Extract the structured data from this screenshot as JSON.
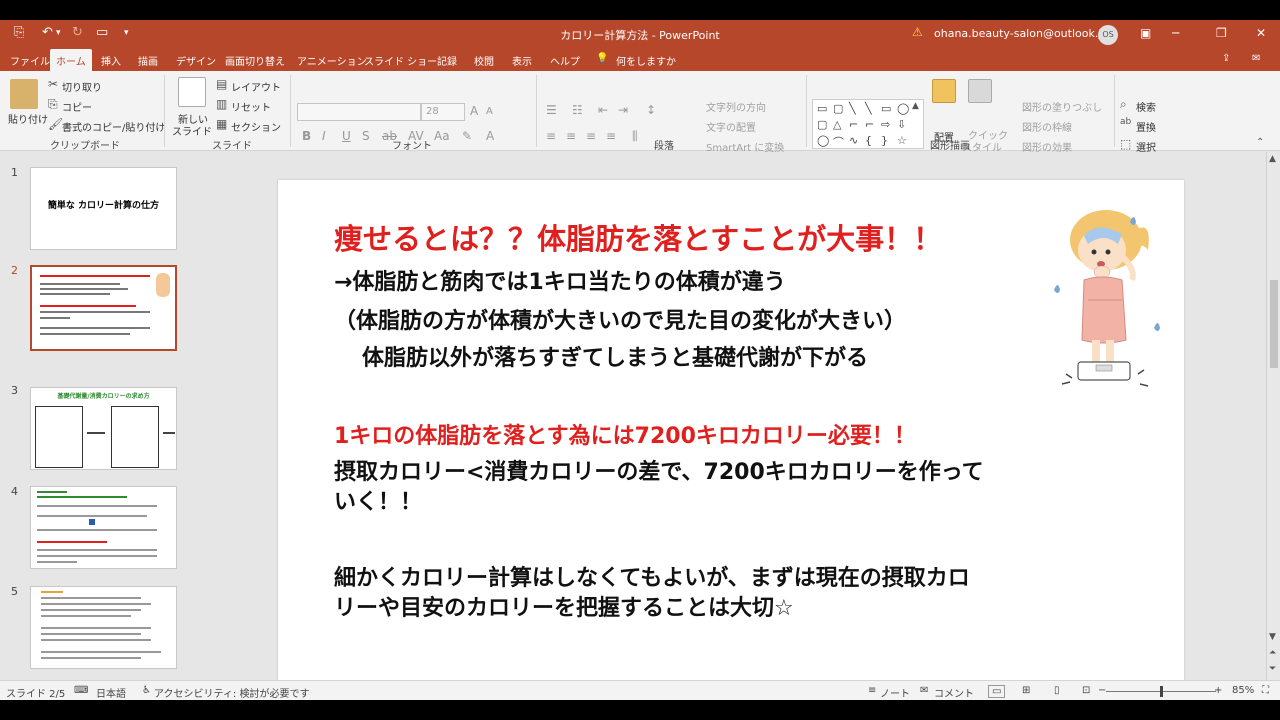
{
  "window": {
    "title": "カロリー計算方法 - PowerPoint",
    "account": "ohana.beauty-salon@outlook.jp",
    "avatar_initials": "OS"
  },
  "tabs": [
    "ファイル",
    "ホーム",
    "挿入",
    "描画",
    "デザイン",
    "画面切り替え",
    "アニメーション",
    "スライド ショー",
    "記録",
    "校閲",
    "表示",
    "ヘルプ",
    "何をしますか"
  ],
  "active_tab": "ホーム",
  "ribbon": {
    "clipboard": {
      "paste": "貼り付け",
      "cut": "切り取り",
      "copy": "コピー",
      "format_painter": "書式のコピー/貼り付け",
      "label": "クリップボード"
    },
    "slides": {
      "new_slide": "新しい",
      "new_slide2": "スライド",
      "layout": "レイアウト",
      "reset": "リセット",
      "section": "セクション",
      "label": "スライド"
    },
    "font": {
      "size": "28",
      "label": "フォント"
    },
    "paragraph": {
      "text_direction": "文字列の方向",
      "align_text": "文字の配置",
      "smartart": "SmartArt に変換",
      "label": "段落"
    },
    "drawing": {
      "arrange": "配置",
      "quick_styles": "クイック",
      "quick_styles2": "スタイル",
      "fill": "図形の塗りつぶし",
      "outline": "図形の枠線",
      "effects": "図形の効果",
      "label": "図形描画"
    },
    "editing": {
      "find": "検索",
      "replace": "置換",
      "select": "選択",
      "label": "編集"
    }
  },
  "thumbnails": [
    {
      "num": "1",
      "title": "簡単な カロリー計算の仕方"
    },
    {
      "num": "2"
    },
    {
      "num": "3",
      "title": "基礎代謝量/消費カロリーの求め方"
    },
    {
      "num": "4"
    },
    {
      "num": "5"
    }
  ],
  "slide": {
    "heading": "痩せるとは？？体脂肪を落とすことが大事！！",
    "line1": "→体脂肪と筋肉では1キロ当たりの体積が違う",
    "line2": "（体脂肪の方が体積が大きいので見た目の変化が大きい）",
    "line3": "体脂肪以外が落ちすぎてしまうと基礎代謝が下がる",
    "red2": "1キロの体脂肪を落とす為には7200キロカロリー必要！！",
    "line4": "摂取カロリー<消費カロリーの差で、7200キロカロリーを作って",
    "line5": "いく！！",
    "line6": "細かくカロリー計算はしなくてもよいが、まずは現在の摂取カロ",
    "line7": "リーや目安のカロリーを把握することは大切☆"
  },
  "status": {
    "slide_info": "スライド 2/5",
    "language": "日本語",
    "accessibility": "アクセシビリティ: 検討が必要です",
    "notes": "ノート",
    "comments": "コメント",
    "zoom": "85%"
  },
  "colors": {
    "accent": "#b7472a",
    "slide_red": "#e0201e"
  }
}
